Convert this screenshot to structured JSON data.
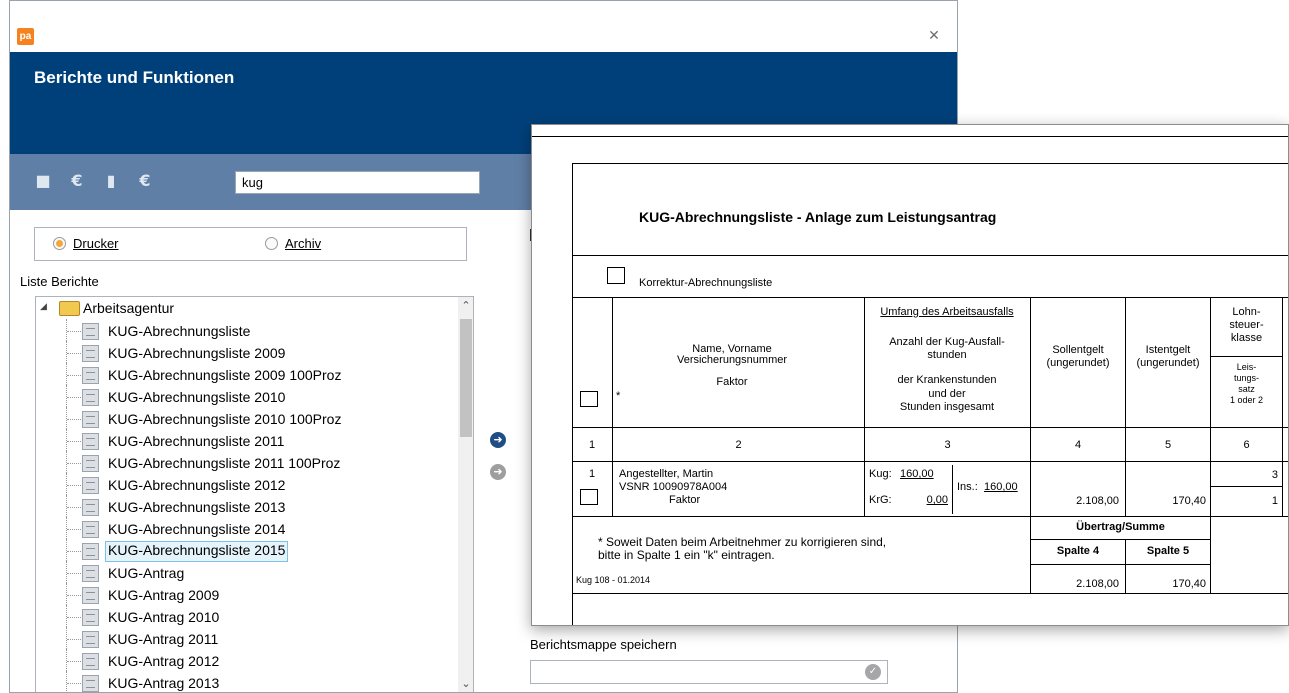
{
  "window": {
    "logo_text": "pa",
    "close_glyph": "✕",
    "header_title": "Berichte und Funktionen"
  },
  "toolbar": {
    "icons": [
      "report-icon",
      "refresh-icon",
      "document-icon",
      "archive-icon"
    ],
    "search_value": "kug"
  },
  "output_mode": {
    "options": [
      {
        "label": "Drucker",
        "selected": true
      },
      {
        "label": "Archiv",
        "selected": false
      }
    ]
  },
  "reports": {
    "heading": "Liste Berichte",
    "root_folder": "Arbeitsagentur",
    "items": [
      "KUG-Abrechnungsliste",
      "KUG-Abrechnungsliste 2009",
      "KUG-Abrechnungsliste 2009 100Proz",
      "KUG-Abrechnungsliste 2010",
      "KUG-Abrechnungsliste 2010 100Proz",
      "KUG-Abrechnungsliste 2011",
      "KUG-Abrechnungsliste 2011 100Proz",
      "KUG-Abrechnungsliste 2012",
      "KUG-Abrechnungsliste 2013",
      "KUG-Abrechnungsliste 2014",
      "KUG-Abrechnungsliste 2015",
      "KUG-Antrag",
      "KUG-Antrag 2009",
      "KUG-Antrag 2010",
      "KUG-Antrag 2011",
      "KUG-Antrag 2012",
      "KUG-Antrag 2013"
    ],
    "selected_index": 10
  },
  "report_folder": {
    "heading": "Berichtsmappe speichern",
    "value": ""
  },
  "preview": {
    "title": "KUG-Abrechnungsliste - Anlage zum Leistungsantrag",
    "korrektur_label": "Korrektur-Abrechnungsliste",
    "header": {
      "asterisk": "*",
      "col2_line1": "Name, Vorname",
      "col2_line2": "Versicherungsnummer",
      "col2_line3": "Faktor",
      "col3_line1": "Umfang des Arbeitsausfalls",
      "col3_line2": "Anzahl der Kug-Ausfall-",
      "col3_line3": "stunden",
      "col3_line4": "der Krankenstunden",
      "col3_line5": "und der",
      "col3_line6": "Stunden insgesamt",
      "col4_line1": "Sollentgelt",
      "col4_line2": "(ungerundet)",
      "col5_line1": "Istentgelt",
      "col5_line2": "(ungerundet)",
      "col6_line1": "Lohn-",
      "col6_line2": "steuer-",
      "col6_line3": "klasse",
      "col6_sub1": "Leis-",
      "col6_sub2": "tungs-",
      "col6_sub3": "satz",
      "col6_sub4": "1 oder 2"
    },
    "column_numbers": [
      "1",
      "2",
      "3",
      "4",
      "5",
      "6"
    ],
    "row": {
      "nr": "1",
      "name": "Angestellter, Martin",
      "vsnr": "VSNR 10090978A004",
      "faktor": "Faktor",
      "kug_label": "Kug:",
      "kug_value": "160,00",
      "krg_label": "KrG:",
      "krg_value": "0,00",
      "ins_label": "Ins.:",
      "ins_value": "160,00",
      "sollentgelt": "2.108,00",
      "istentgelt": "170,40",
      "steuerklasse": "3",
      "leistungssatz": "1"
    },
    "footer": {
      "note_line1": "* Soweit Daten beim Arbeitnehmer zu korrigieren sind,",
      "note_line2": "bitte in Spalte 1 ein \"k\" eintragen.",
      "uebertrag_label": "Übertrag/Summe",
      "spalte4_label": "Spalte 4",
      "spalte5_label": "Spalte 5",
      "sum_spalte4": "2.108,00",
      "sum_spalte5": "170,40",
      "form_code": "Kug 108 - 01.2014"
    }
  }
}
